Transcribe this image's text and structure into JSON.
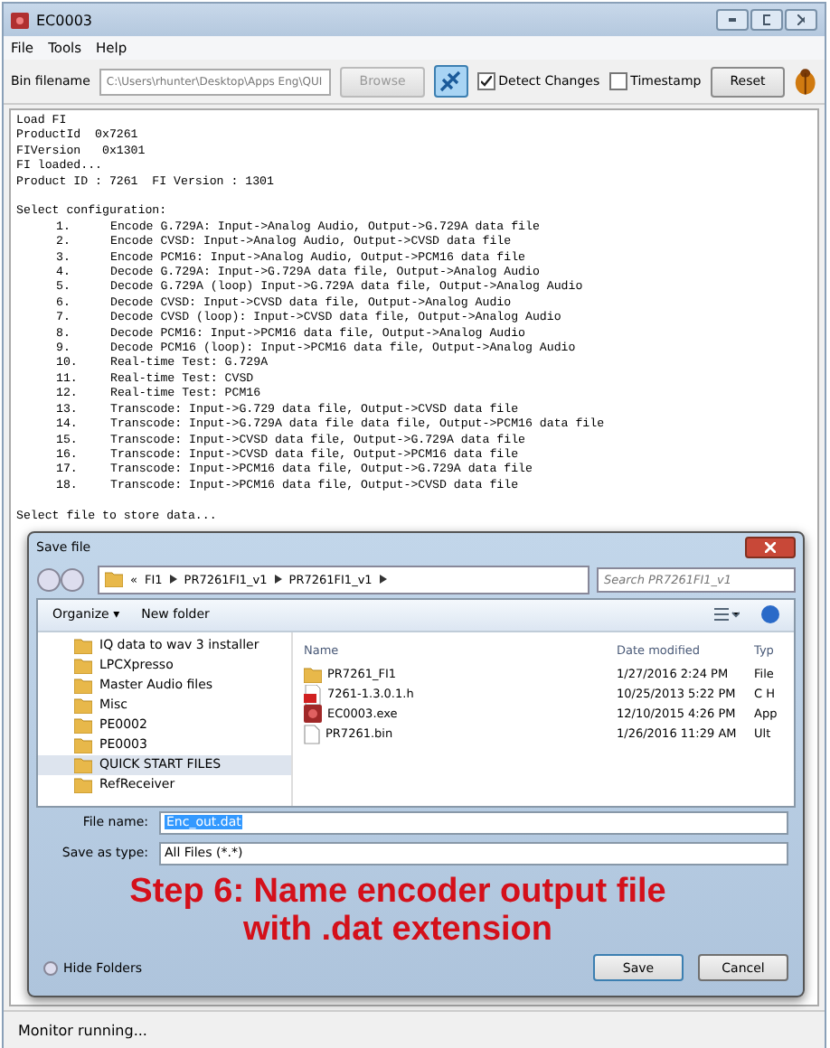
{
  "window": {
    "title": "EC0003"
  },
  "menu": [
    "File",
    "Tools",
    "Help"
  ],
  "toolbar": {
    "label": "Bin filename",
    "path": "C:\\Users\\rhunter\\Desktop\\Apps Eng\\QUI",
    "browse": {
      "label": "Browse",
      "disabled": true
    },
    "checkboxes": [
      {
        "label": "Detect Changes",
        "checked": true
      },
      {
        "label": "Timestamp",
        "checked": false
      }
    ],
    "reset": "Reset"
  },
  "console": {
    "header": [
      "Load FI",
      "ProductId  0x7261",
      "FIVersion   0x1301",
      "FI loaded...",
      "Product ID : 7261  FI Version : 1301"
    ],
    "prompt": "Select configuration:",
    "options": [
      {
        "number": "1.",
        "text": "Encode G.729A: Input->Analog Audio, Output->G.729A data file"
      },
      {
        "number": "2.",
        "text": "Encode CVSD: Input->Analog Audio, Output->CVSD data file"
      },
      {
        "number": "3.",
        "text": "Encode PCM16: Input->Analog Audio, Output->PCM16 data file"
      },
      {
        "number": "4.",
        "text": "Decode G.729A: Input->G.729A data file, Output->Analog Audio"
      },
      {
        "number": "5.",
        "text": "Decode G.729A (loop) Input->G.729A data file, Output->Analog Audio"
      },
      {
        "number": "6.",
        "text": "Decode CVSD: Input->CVSD data file, Output->Analog Audio"
      },
      {
        "number": "7.",
        "text": "Decode CVSD (loop): Input->CVSD data file, Output->Analog Audio"
      },
      {
        "number": "8.",
        "text": "Decode PCM16: Input->PCM16 data file, Output->Analog Audio"
      },
      {
        "number": "9.",
        "text": "Decode PCM16 (loop): Input->PCM16 data file, Output->Analog Audio"
      },
      {
        "number": "10.",
        "text": "Real-time Test: G.729A"
      },
      {
        "number": "11.",
        "text": "Real-time Test: CVSD"
      },
      {
        "number": "12.",
        "text": "Real-time Test: PCM16"
      },
      {
        "number": "13.",
        "text": "Transcode: Input->G.729 data file, Output->CVSD data file"
      },
      {
        "number": "14.",
        "text": "Transcode: Input->G.729A data file data file, Output->PCM16 data file"
      },
      {
        "number": "15.",
        "text": "Transcode: Input->CVSD data file, Output->G.729A data file"
      },
      {
        "number": "16.",
        "text": "Transcode: Input->CVSD data file, Output->PCM16 data file"
      },
      {
        "number": "17.",
        "text": "Transcode: Input->PCM16 data file, Output->G.729A data file"
      },
      {
        "number": "18.",
        "text": "Transcode: Input->PCM16 data file, Output->CVSD data file"
      }
    ],
    "footer": "Select file to store data..."
  },
  "dialog": {
    "title": "Save file",
    "breadcrumb": [
      "«",
      "FI1",
      "PR7261FI1_v1",
      "PR7261FI1_v1"
    ],
    "search": {
      "placeholder": "Search PR7261FI1_v1"
    },
    "commands": [
      "Organize ▾",
      "New folder"
    ],
    "folders": [
      {
        "label": "IQ data to wav 3 installer",
        "selected": false
      },
      {
        "label": "LPCXpresso",
        "selected": false
      },
      {
        "label": "Master Audio files",
        "selected": false
      },
      {
        "label": "Misc",
        "selected": false
      },
      {
        "label": "PE0002",
        "selected": false
      },
      {
        "label": "PE0003",
        "selected": false
      },
      {
        "label": "QUICK START FILES",
        "selected": true
      },
      {
        "label": "RefReceiver",
        "selected": false
      }
    ],
    "columns": [
      "Name",
      "Date modified",
      "Typ"
    ],
    "files": [
      {
        "kind": "folder",
        "name": "PR7261_FI1",
        "date": "1/27/2016 2:24 PM",
        "type": "File"
      },
      {
        "kind": "header",
        "name": "7261-1.3.0.1.h",
        "date": "10/25/2013 5:22 PM",
        "type": "C H"
      },
      {
        "kind": "exe",
        "name": "EC0003.exe",
        "date": "12/10/2015 4:26 PM",
        "type": "App"
      },
      {
        "kind": "bin",
        "name": "PR7261.bin",
        "date": "1/26/2016 11:29 AM",
        "type": "Ult"
      }
    ],
    "file_name": {
      "label": "File name:",
      "value": "Enc_out.dat"
    },
    "save_type": {
      "label": "Save as type:",
      "value": "All Files (*.*)"
    },
    "annotation": "Step 6: Name encoder output file with .dat extension",
    "hide_folders": "Hide Folders",
    "buttons": [
      "Save",
      "Cancel"
    ]
  },
  "status_bar": "Monitor running..."
}
